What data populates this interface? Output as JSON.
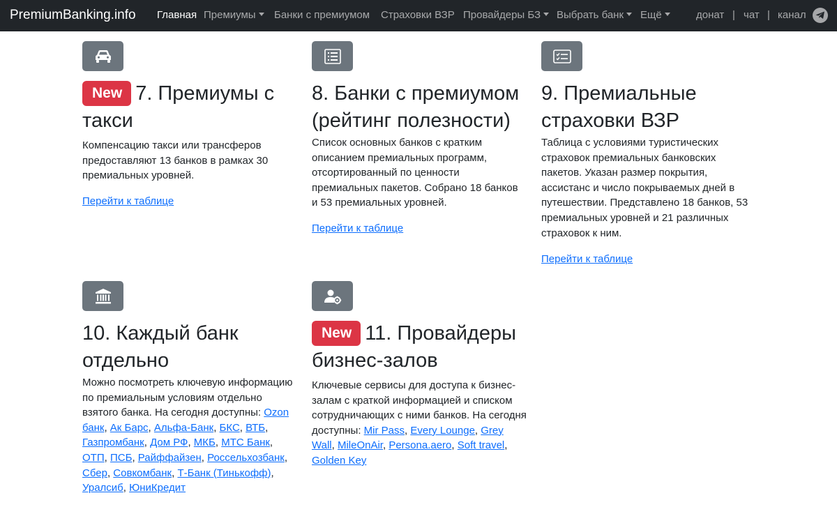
{
  "navbar": {
    "brand": "PremiumBanking.info",
    "items": [
      {
        "label": "Главная",
        "active": true
      },
      {
        "label": "Премиумы",
        "dropdown": true
      },
      {
        "label": "Банки с премиумом"
      },
      {
        "label": "Страховки ВЗР"
      },
      {
        "label": "Провайдеры БЗ",
        "dropdown": true
      },
      {
        "label": "Выбрать банк",
        "dropdown": true
      },
      {
        "label": "Ещё",
        "dropdown": true
      }
    ],
    "right": {
      "donate": "донат",
      "chat": "чат",
      "channel": "канал",
      "separator": "|"
    },
    "telegram_icon": "telegram-icon"
  },
  "cards": {
    "c7": {
      "icon": "taxi-car-icon",
      "badge": "New",
      "title": "7. Премиумы с такси",
      "desc": "Компенсацию такси или трансферов предоставляют 13 банков в рамках 30 премиальных уровней.",
      "link": "Перейти к таблице"
    },
    "c8": {
      "icon": "list-icon",
      "title": "8. Банки с премиумом (рейтинг полезности)",
      "desc": "Список основных банков с кратким описанием премиальных программ, отсортированный по ценности премиальных пакетов. Собрано 18 банков и 53 премиальных уровней.",
      "link": "Перейти к таблице"
    },
    "c9": {
      "icon": "card-checklist-icon",
      "title": "9. Премиальные страховки ВЗР",
      "desc": "Таблица с условиями туристических страховок премиальных банковских пакетов. Указан размер покрытия, ассистанс и число покрываемых дней в путешествии. Представлено 18 банков, 53 премиальных уровней и 21 различных страховок к ним.",
      "link": "Перейти к таблице"
    },
    "c10": {
      "icon": "bank-building-icon",
      "title": "10. Каждый банк отдельно",
      "desc": "Можно посмотреть ключевую информацию по премиальным условиям отдельно взятого банка. На сегодня доступны: ",
      "banks": [
        "Ozon банк",
        "Ак Барс",
        "Альфа-Банк",
        "БКС",
        "ВТБ",
        "Газпромбанк",
        "Дом РФ",
        "МКБ",
        "МТС Банк",
        "ОТП",
        "ПСБ",
        "Райффайзен",
        "Россельхозбанк",
        "Сбер",
        "Совкомбанк",
        "Т-Банк (Тинькофф)",
        "Уралсиб",
        "ЮниКредит"
      ],
      "separator": ", "
    },
    "c11": {
      "icon": "person-gear-icon",
      "badge": "New",
      "title": "11. Провайдеры бизнес-залов",
      "desc": "Ключевые сервисы для доступа к бизнес-залам с краткой информацией и списком сотрудничающих с ними банков. На сегодня доступны: ",
      "providers": [
        "Mir Pass",
        "Every Lounge",
        "Grey Wall",
        "MileOnAir",
        "Persona.aero",
        "Soft travel",
        "Golden Key"
      ],
      "separator": ", "
    }
  }
}
